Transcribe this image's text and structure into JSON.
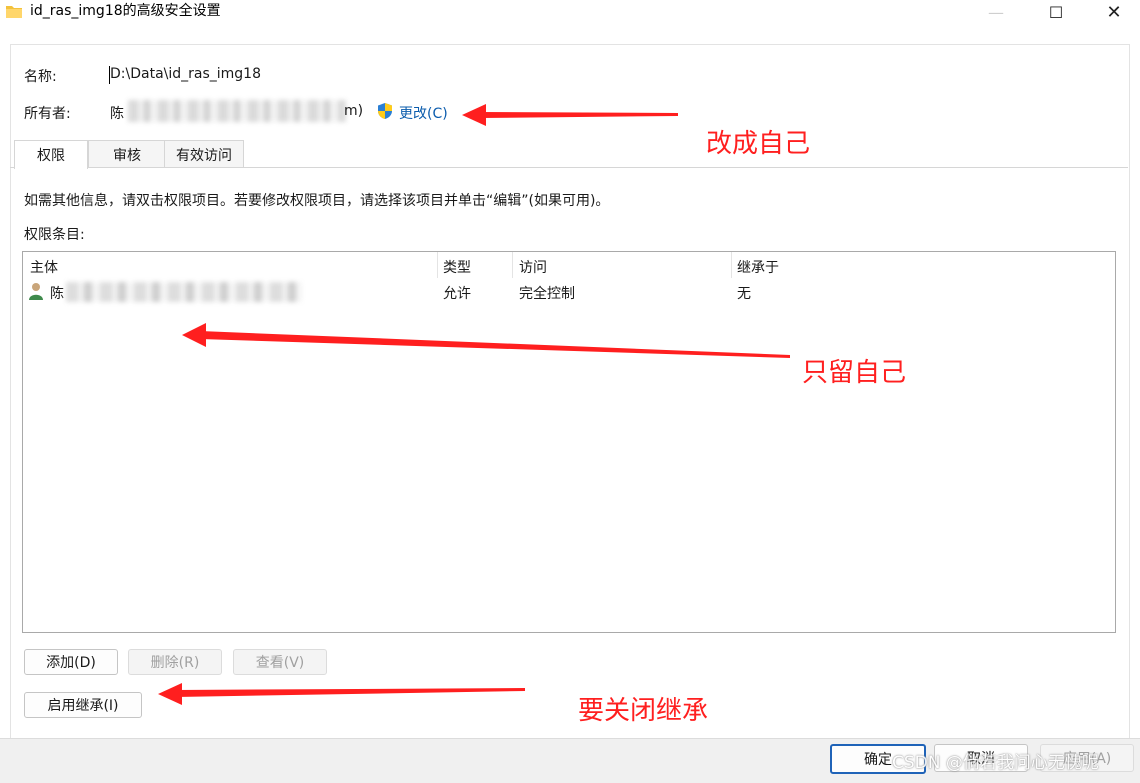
{
  "window": {
    "title": "id_ras_img18的高级安全设置",
    "minimize_glyph": "—",
    "maximize_glyph": "☐",
    "close_glyph": "✕"
  },
  "header": {
    "name_label": "名称:",
    "name_value": "D:\\Data\\id_ras_img18",
    "owner_label": "所有者:",
    "owner_value_prefix": "陈",
    "owner_value_suffix": "m)",
    "change_link": "更改(C)"
  },
  "tabs": [
    {
      "label": "权限",
      "active": true
    },
    {
      "label": "审核",
      "active": false
    },
    {
      "label": "有效访问",
      "active": false
    }
  ],
  "info_text": "如需其他信息，请双击权限项目。若要修改权限项目，请选择该项目并单击“编辑”(如果可用)。",
  "entries_label": "权限条目:",
  "table": {
    "columns": [
      "主体",
      "类型",
      "访问",
      "继承于"
    ],
    "rows": [
      {
        "principal": "陈",
        "type": "允许",
        "access": "完全控制",
        "inherited_from": "无"
      }
    ]
  },
  "buttons": {
    "add": "添加(D)",
    "remove": "删除(R)",
    "view": "查看(V)",
    "enable_inheritance": "启用继承(I)",
    "ok": "确定",
    "cancel": "取消",
    "apply": "应用(A)"
  },
  "annotations": {
    "change_owner": "改成自己",
    "keep_only_self": "只留自己",
    "disable_inheritance": "要关闭继承"
  },
  "watermark": "CSDN @倘若我问心无愧呢",
  "colors": {
    "annotation_red": "#ff1f1f",
    "link_blue": "#0b5cad",
    "default_button_border": "#1f63b8",
    "folder_yellow": "#f3c23c"
  },
  "icons": {
    "title": "folder-icon",
    "change": "uac-shield-icon",
    "principal": "user-icon"
  }
}
